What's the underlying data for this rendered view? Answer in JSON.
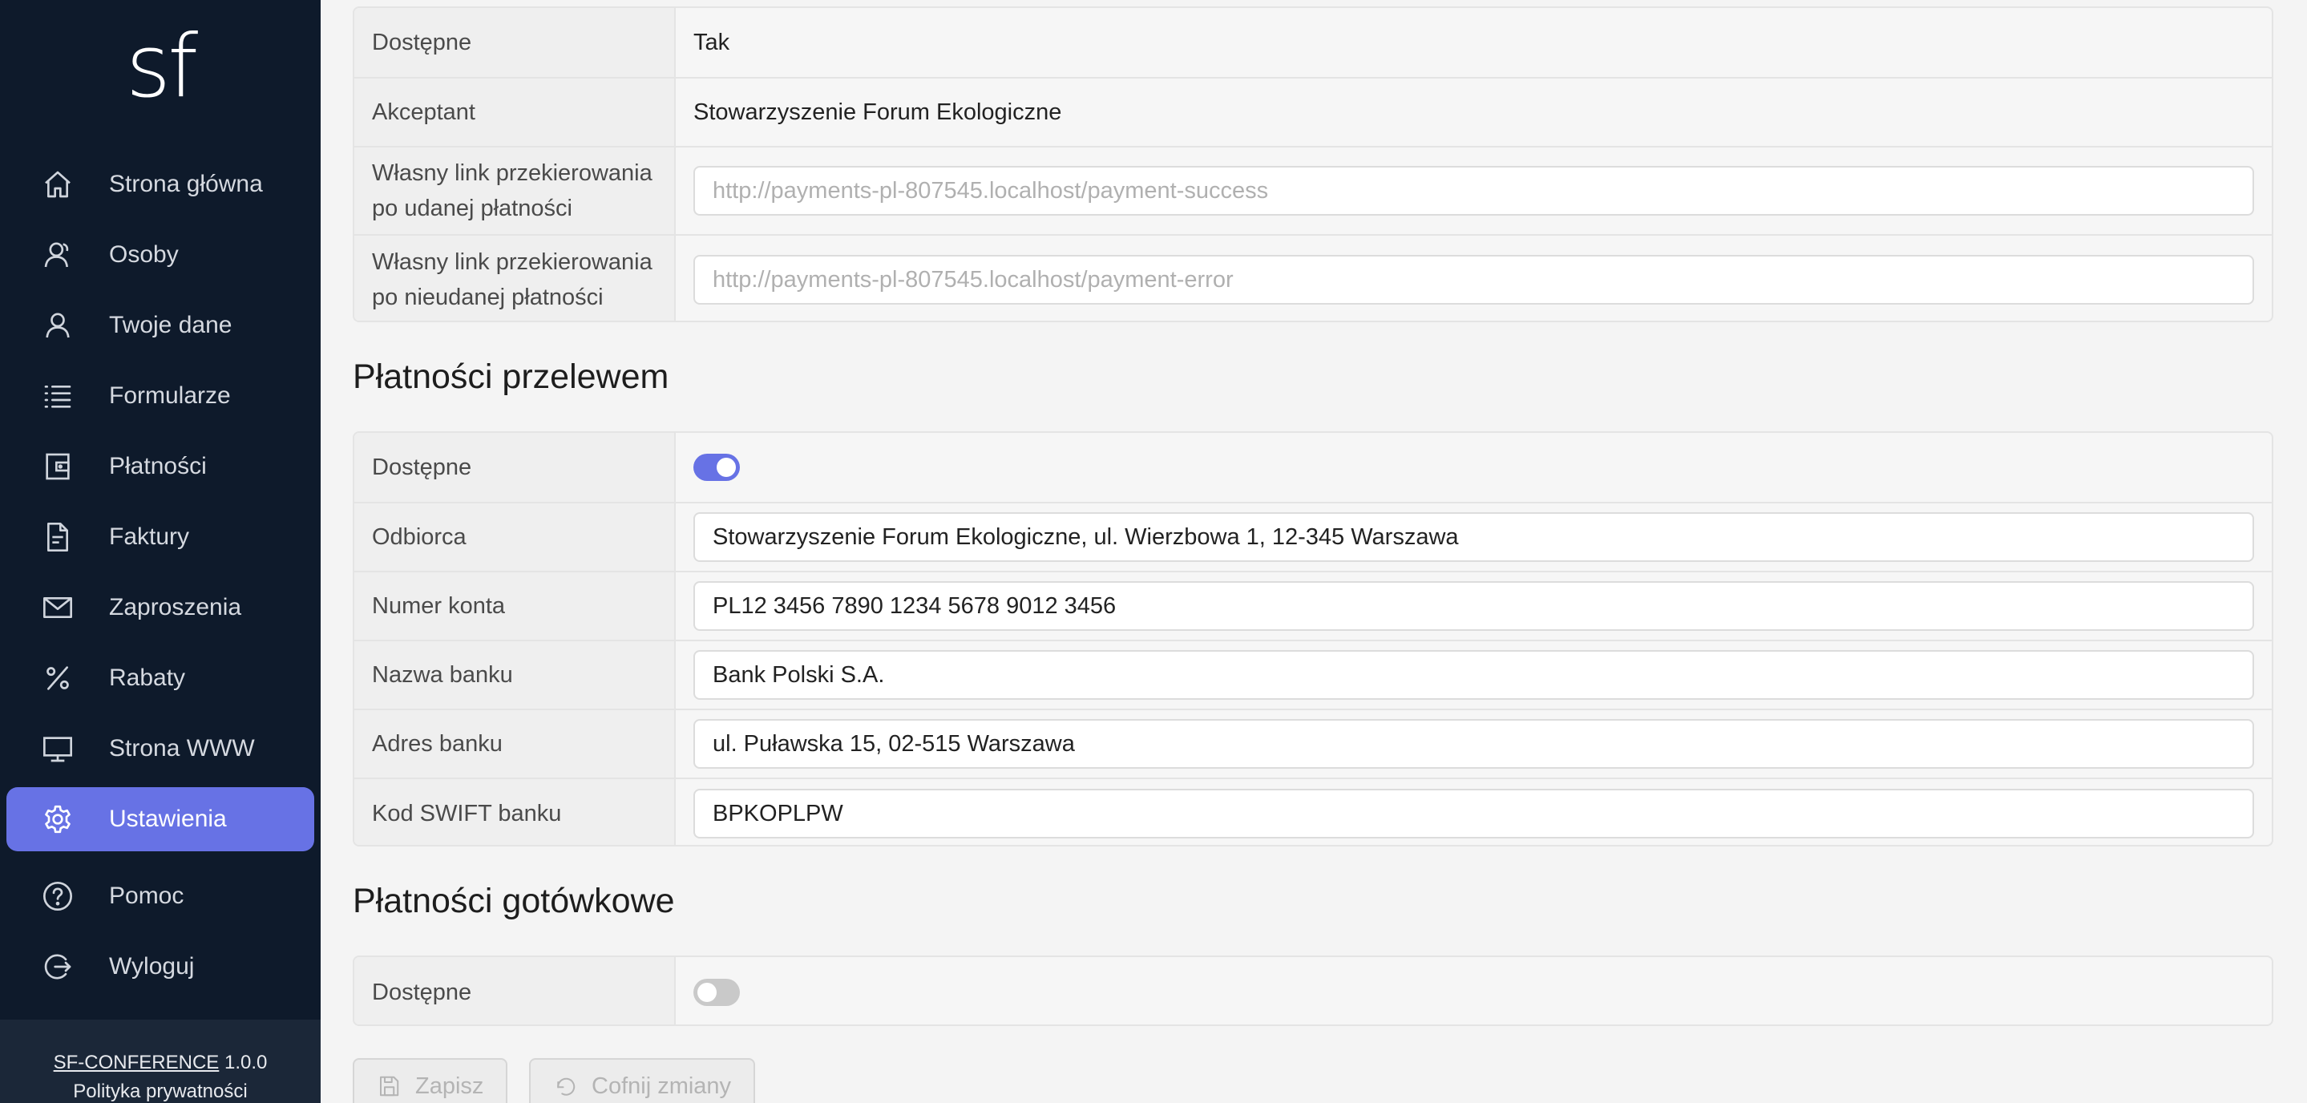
{
  "app": {
    "logo": "sf"
  },
  "nav": [
    {
      "label": "Strona główna",
      "icon": "home-icon"
    },
    {
      "label": "Osoby",
      "icon": "people-icon"
    },
    {
      "label": "Twoje dane",
      "icon": "user-icon"
    },
    {
      "label": "Formularze",
      "icon": "list-icon"
    },
    {
      "label": "Płatności",
      "icon": "wallet-icon"
    },
    {
      "label": "Faktury",
      "icon": "document-icon"
    },
    {
      "label": "Zaproszenia",
      "icon": "envelope-icon"
    },
    {
      "label": "Rabaty",
      "icon": "percent-icon"
    },
    {
      "label": "Strona WWW",
      "icon": "monitor-icon"
    },
    {
      "label": "Ustawienia",
      "icon": "gear-icon",
      "active": true
    },
    {
      "label": "Pomoc",
      "icon": "help-icon"
    },
    {
      "label": "Wyloguj",
      "icon": "logout-icon"
    }
  ],
  "footer": {
    "app_link": "SF-CONFERENCE",
    "version": "1.0.0",
    "privacy": "Polityka prywatności"
  },
  "online_payments": {
    "rows": [
      {
        "label": "Dostępne",
        "value": "Tak"
      },
      {
        "label": "Akceptant",
        "value": "Stowarzyszenie Forum Ekologiczne"
      },
      {
        "label": "Własny link przekierowania po udanej płatności",
        "placeholder": "http://payments-pl-807545.localhost/payment-success",
        "value": ""
      },
      {
        "label": "Własny link przekierowania po nieudanej płatności",
        "placeholder": "http://payments-pl-807545.localhost/payment-error",
        "value": ""
      }
    ]
  },
  "transfer": {
    "title": "Płatności przelewem",
    "available_label": "Dostępne",
    "available": true,
    "recipient_label": "Odbiorca",
    "recipient": "Stowarzyszenie Forum Ekologiczne, ul. Wierzbowa 1, 12-345 Warszawa",
    "account_label": "Numer konta",
    "account": "PL12 3456 7890 1234 5678 9012 3456",
    "bank_name_label": "Nazwa banku",
    "bank_name": "Bank Polski S.A.",
    "bank_address_label": "Adres banku",
    "bank_address": "ul. Puławska 15, 02-515 Warszawa",
    "swift_label": "Kod SWIFT banku",
    "swift": "BPKOPLPW"
  },
  "cash": {
    "title": "Płatności gotówkowe",
    "available_label": "Dostępne",
    "available": false
  },
  "actions": {
    "save": "Zapisz",
    "revert": "Cofnij zmiany"
  },
  "colors": {
    "sidebar_bg": "#0e1a2b",
    "accent": "#6772e5",
    "toggle_off": "#c9c9c9"
  }
}
